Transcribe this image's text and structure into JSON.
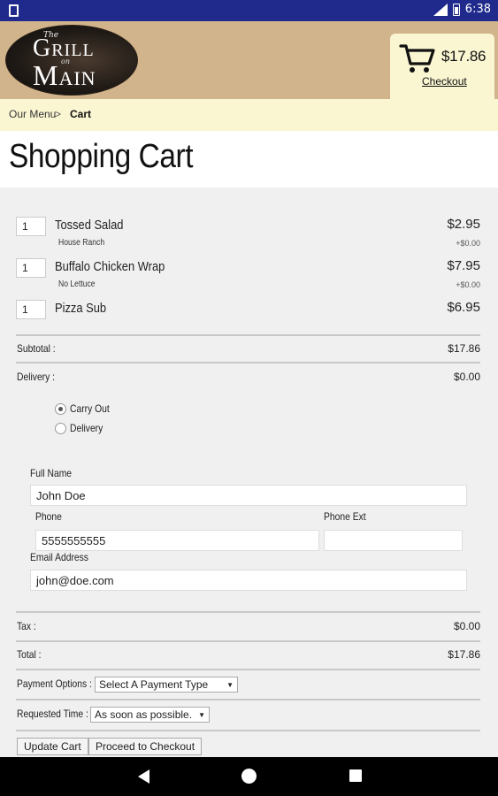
{
  "status_bar": {
    "time": "6:38",
    "network": "LTE"
  },
  "header": {
    "logo": {
      "line1": "The",
      "line2": "Grill",
      "line3": "on",
      "line4": "Main"
    },
    "cart_total": "$17.86",
    "checkout_link": "Checkout"
  },
  "breadcrumb": {
    "parent": "Our Menu",
    "separator": ">",
    "current": "Cart"
  },
  "page_title": "Shopping Cart",
  "items": [
    {
      "qty": "1",
      "name": "Tossed Salad",
      "modifier": "House Ranch",
      "price": "$2.95",
      "modifier_price": "+$0.00"
    },
    {
      "qty": "1",
      "name": "Buffalo Chicken Wrap",
      "modifier": "No Lettuce",
      "price": "$7.95",
      "modifier_price": "+$0.00"
    },
    {
      "qty": "1",
      "name": "Pizza Sub",
      "price": "$6.95"
    }
  ],
  "subtotal": {
    "label": "Subtotal :",
    "value": "$17.86"
  },
  "delivery": {
    "label": "Delivery :",
    "value": "$0.00",
    "options": [
      "Carry Out",
      "Delivery"
    ],
    "selected": "Carry Out"
  },
  "form": {
    "full_name_label": "Full Name",
    "full_name": "John Doe",
    "phone_label": "Phone",
    "phone": "5555555555",
    "phone_ext_label": "Phone Ext",
    "phone_ext": "",
    "email_label": "Email Address",
    "email": "john@doe.com"
  },
  "tax": {
    "label": "Tax :",
    "value": "$0.00"
  },
  "total": {
    "label": "Total :",
    "value": "$17.86"
  },
  "payment": {
    "label": "Payment Options :",
    "selected": "Select A Payment Type"
  },
  "requested_time": {
    "label": "Requested Time :",
    "selected": "As soon as possible."
  },
  "buttons": {
    "update_cart": "Update Cart",
    "proceed": "Proceed to Checkout"
  },
  "colors": {
    "status_bar": "#1f2a8c",
    "header_bg": "#d2b48c",
    "accent_bg": "#faf6d2",
    "page_bg": "#f0f0f0"
  }
}
